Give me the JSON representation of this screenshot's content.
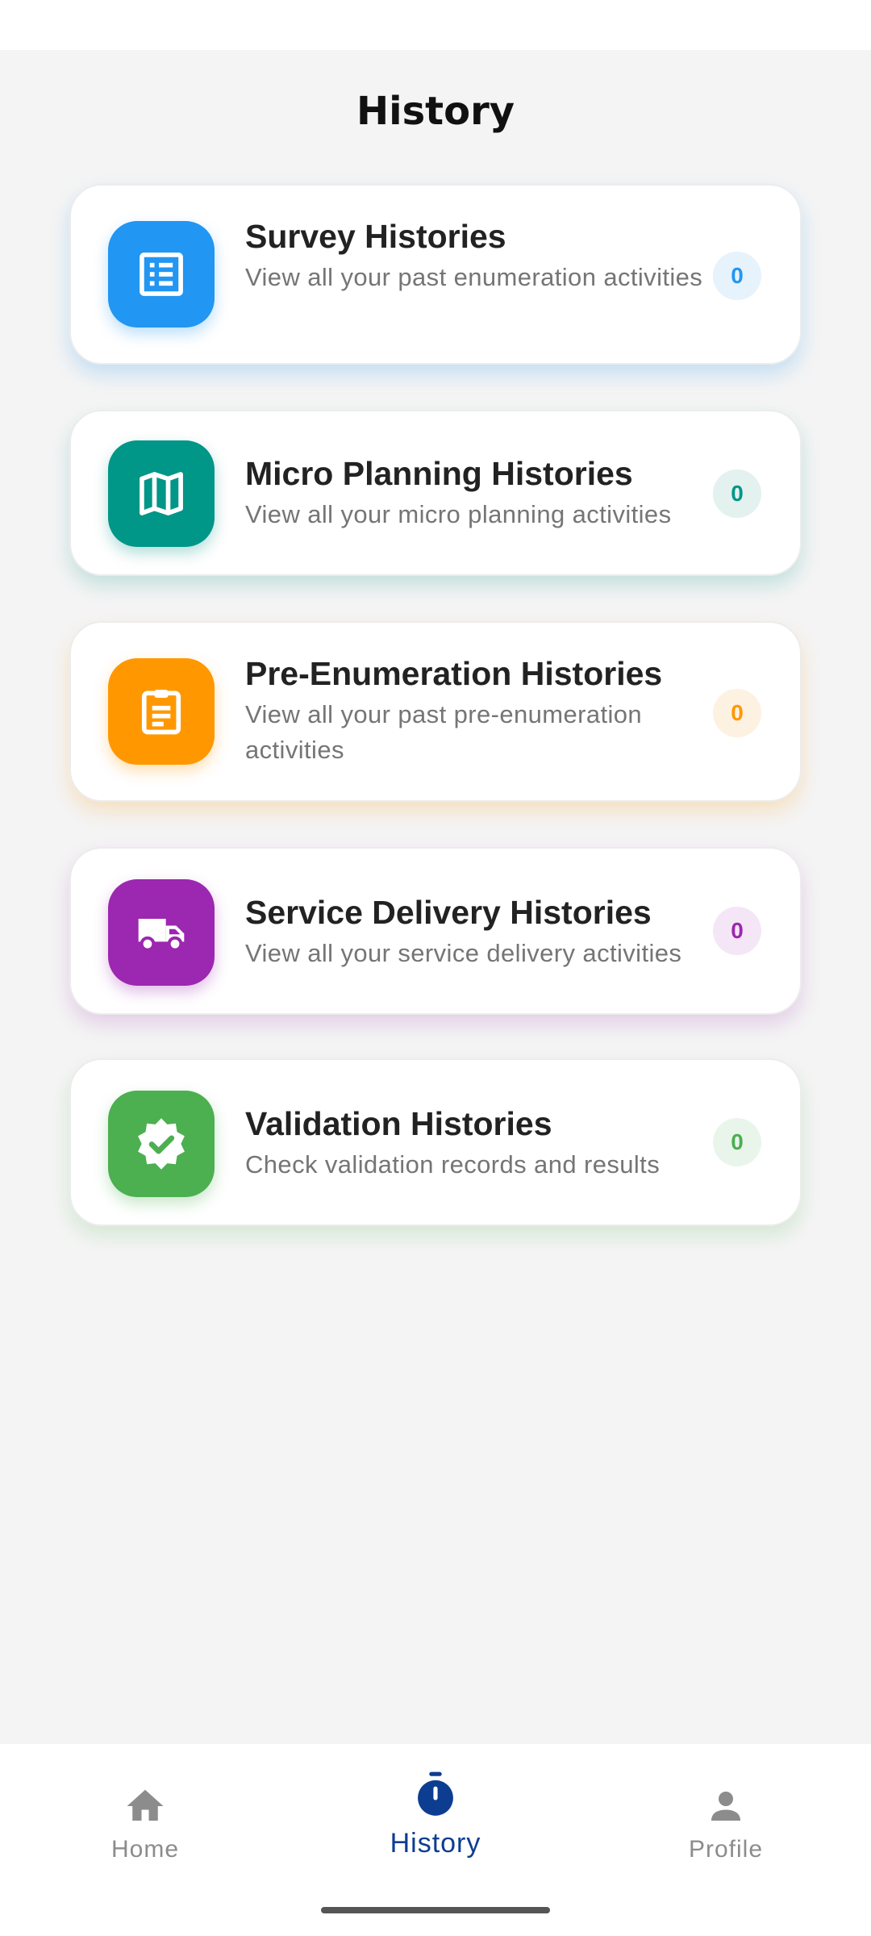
{
  "header": {
    "title": "History"
  },
  "cards": [
    {
      "title": "Survey Histories",
      "description": "View all your past enumeration activities",
      "count": "0",
      "icon": "list-icon",
      "color": "#2196f3",
      "badge_bg": "#e6f2fc"
    },
    {
      "title": "Micro Planning Histories",
      "description": "View all your micro planning activities",
      "count": "0",
      "icon": "map-icon",
      "color": "#009688",
      "badge_bg": "#e3f1ef"
    },
    {
      "title": "Pre-Enumeration Histories",
      "description": "View all your past pre-enumeration activities",
      "count": "0",
      "icon": "clipboard-icon",
      "color": "#ff9800",
      "badge_bg": "#fdf1e2"
    },
    {
      "title": "Service Delivery Histories",
      "description": "View all your service delivery activities",
      "count": "0",
      "icon": "truck-icon",
      "color": "#9c27b0",
      "badge_bg": "#f4e6f6"
    },
    {
      "title": "Validation Histories",
      "description": "Check validation records and results",
      "count": "0",
      "icon": "verified-badge-icon",
      "color": "#4caf50",
      "badge_bg": "#e9f5ea"
    }
  ],
  "bottom_nav": {
    "items": [
      {
        "label": "Home",
        "icon": "home-icon",
        "active": false
      },
      {
        "label": "History",
        "icon": "stopwatch-icon",
        "active": true
      },
      {
        "label": "Profile",
        "icon": "person-icon",
        "active": false
      }
    ],
    "active_color": "#0d3d91",
    "inactive_color": "#8c8c8c"
  }
}
